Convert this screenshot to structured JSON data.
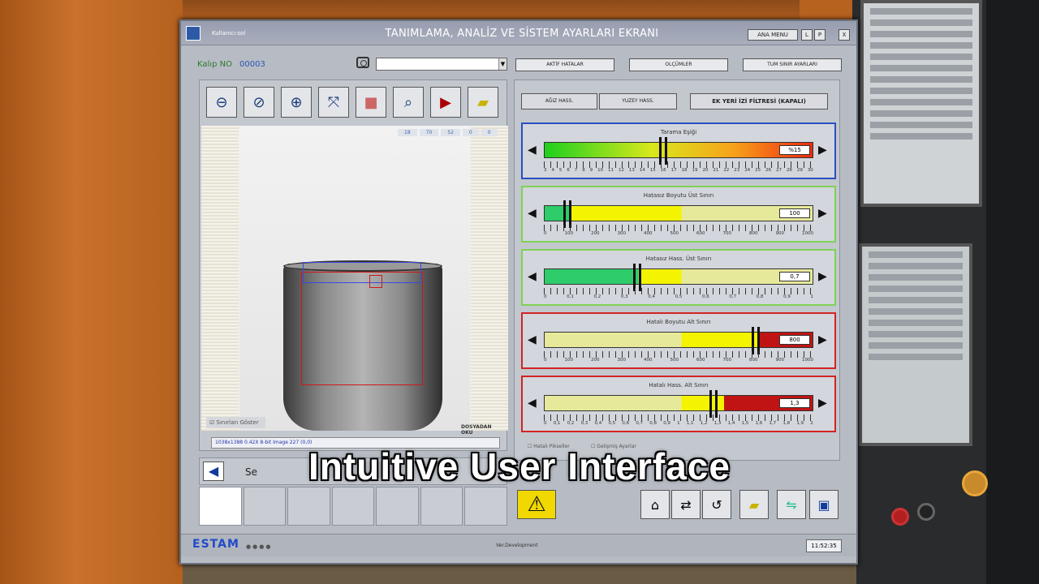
{
  "window": {
    "title": "TANIMLAMA, ANALİZ VE SİSTEM AYARLARI EKRANI",
    "user": "Kullanıcı:sol",
    "menu_label": "ANA MENU",
    "btn_l": "L",
    "btn_p": "P",
    "close": "X"
  },
  "toolbar": {
    "kalip_label": "Kalıp NO",
    "kalip_value": "00003",
    "active_errors": "AKTİF HATALAR",
    "measurements": "OLÇÜMLER",
    "all_limits": "TUM SINIR AYARLARI"
  },
  "image": {
    "coords": [
      "18",
      "70",
      "52",
      "0",
      "0"
    ],
    "file_label": "DOSYADAN OKU",
    "show_limits": "Sınırları Göster",
    "status": "1038x1388 0.42X 8-bit Image 227   (0,0)"
  },
  "modes": {
    "mouth": "AĞIZ HASS.",
    "surface": "YUZEY HASS.",
    "filter": "EK YERİ İZİ FİLTRESİ (KAPALI)"
  },
  "sliders": [
    {
      "title": "Tarama Eşiği",
      "value": "%15",
      "ticks": [
        "3",
        "4",
        "5",
        "6",
        "7",
        "8",
        "9",
        "10",
        "11",
        "12",
        "13",
        "14",
        "15",
        "16",
        "17",
        "18",
        "19",
        "20",
        "21",
        "22",
        "23",
        "24",
        "25",
        "26",
        "27",
        "28",
        "29",
        "30"
      ]
    },
    {
      "title": "Hatasız Boyutu Üst Sınırı",
      "value": "100",
      "ticks": [
        "0",
        "100",
        "200",
        "300",
        "400",
        "500",
        "600",
        "700",
        "800",
        "900",
        "1000"
      ]
    },
    {
      "title": "Hatasız Hass. Üst Sınırı",
      "value": "0,7",
      "ticks": [
        "0",
        "0,1",
        "0,2",
        "0,3",
        "0,4",
        "0,5",
        "0,6",
        "0,7",
        "0,8",
        "0,9",
        "1"
      ]
    },
    {
      "title": "Hatalı Boyutu Alt Sınırı",
      "value": "800",
      "ticks": [
        "0",
        "100",
        "200",
        "300",
        "400",
        "500",
        "600",
        "700",
        "800",
        "900",
        "1000"
      ]
    },
    {
      "title": "Hatalı Hass. Alt Sınırı",
      "value": "1,3",
      "ticks": [
        "0",
        "0,1",
        "0,2",
        "0,3",
        "0,4",
        "0,5",
        "0,6",
        "0,7",
        "0,8",
        "0,9",
        "1",
        "1,1",
        "1,2",
        "1,3",
        "1,4",
        "1,5",
        "1,6",
        "1,7",
        "1,8",
        "1,9",
        "2"
      ]
    }
  ],
  "checkbox": {
    "errors": "Hatalı Pikseller",
    "advanced": "Gelişmiş Ayarlar"
  },
  "footer": {
    "brand": "ESTAM",
    "version": "Ver.Development",
    "time": "11:52:35"
  },
  "caption": "Intuitive User Interface",
  "nav": {
    "partial_text": "Se"
  }
}
